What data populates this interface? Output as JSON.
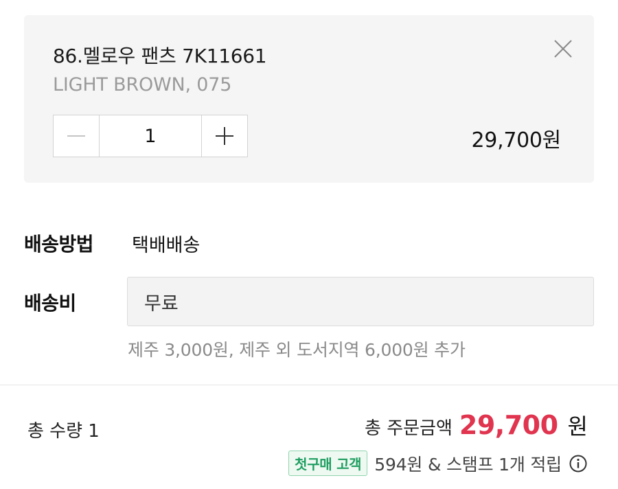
{
  "selected_option": {
    "product_name": "86.멜로우 팬츠 7K11661",
    "option": "LIGHT BROWN, 075",
    "quantity": "1",
    "price": "29,700원"
  },
  "delivery": {
    "method_label": "배송방법",
    "method_value": "택배배송",
    "fee_label": "배송비",
    "fee_value": "무료",
    "fee_note": "제주 3,000원, 제주 외 도서지역 6,000원 추가"
  },
  "summary": {
    "total_qty": "총 수량 1",
    "total_amount_label": "총 주문금액",
    "total_amount": "29,700",
    "currency_unit": "원",
    "first_buyer_badge": "첫구매 고객",
    "reward_text": "594원 & 스탬프 1개 적립"
  },
  "colors": {
    "accent_price": "#e0344f",
    "badge_green": "#1e9e60",
    "card_bg": "#f5f5f5"
  },
  "icons": [
    "close-icon",
    "minus-icon",
    "plus-icon",
    "info-icon"
  ]
}
